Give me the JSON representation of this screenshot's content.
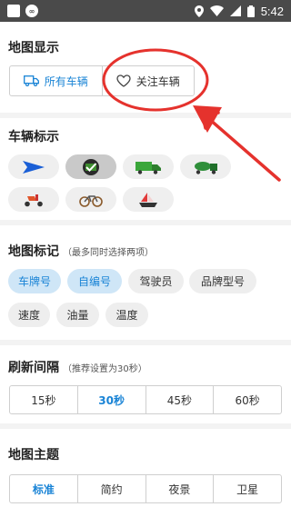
{
  "status_bar": {
    "time": "5:42",
    "icons": [
      "square-icon",
      "cloud-icon",
      "location-icon",
      "wifi-icon",
      "signal-icon",
      "battery-icon"
    ]
  },
  "map_display": {
    "title": "地图显示",
    "options": [
      {
        "label": "所有车辆",
        "icon": "truck-icon",
        "active": true
      },
      {
        "label": "关注车辆",
        "icon": "heart-icon",
        "active": false
      }
    ]
  },
  "vehicle_marker": {
    "title": "车辆标示",
    "icons": [
      "arrow-icon",
      "check-icon",
      "truck-icon",
      "mixer-truck-icon",
      "scooter-icon",
      "bicycle-icon",
      "boat-icon"
    ],
    "selected_index": 1
  },
  "map_label": {
    "title": "地图标记",
    "hint": "（最多同时选择两项）",
    "tags": [
      {
        "label": "车牌号",
        "on": true
      },
      {
        "label": "自编号",
        "on": true
      },
      {
        "label": "驾驶员",
        "on": false
      },
      {
        "label": "品牌型号",
        "on": false
      },
      {
        "label": "速度",
        "on": false
      },
      {
        "label": "油量",
        "on": false
      },
      {
        "label": "温度",
        "on": false
      }
    ]
  },
  "refresh": {
    "title": "刷新间隔",
    "hint": "（推荐设置为30秒）",
    "options": [
      "15秒",
      "30秒",
      "45秒",
      "60秒"
    ],
    "selected_index": 1
  },
  "theme": {
    "title": "地图主题",
    "options": [
      "标准",
      "简约",
      "夜景",
      "卫星"
    ],
    "selected_index": 0
  },
  "colors": {
    "accent": "#1a84d6",
    "annotation": "#e5322d"
  }
}
